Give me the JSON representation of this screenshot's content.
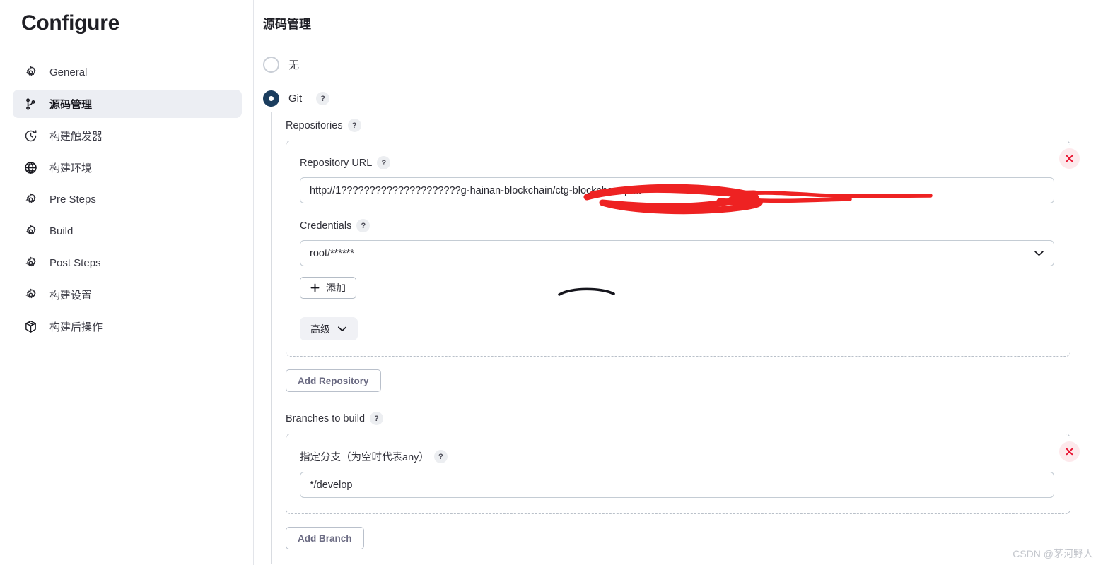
{
  "page": {
    "title": "Configure",
    "watermark": "CSDN @茅河野人"
  },
  "sidebar": {
    "items": [
      {
        "label": "General",
        "icon": "gear-icon",
        "active": false
      },
      {
        "label": "源码管理",
        "icon": "git-branch-icon",
        "active": true
      },
      {
        "label": "构建触发器",
        "icon": "clock-icon",
        "active": false
      },
      {
        "label": "构建环境",
        "icon": "globe-icon",
        "active": false
      },
      {
        "label": "Pre Steps",
        "icon": "gear-icon",
        "active": false
      },
      {
        "label": "Build",
        "icon": "gear-icon",
        "active": false
      },
      {
        "label": "Post Steps",
        "icon": "gear-icon",
        "active": false
      },
      {
        "label": "构建设置",
        "icon": "gear-icon",
        "active": false
      },
      {
        "label": "构建后操作",
        "icon": "package-icon",
        "active": false
      }
    ]
  },
  "main": {
    "section_title": "源码管理",
    "scm_options": [
      {
        "label": "无",
        "selected": false
      },
      {
        "label": "Git",
        "selected": true,
        "help": "?"
      }
    ],
    "repositories": {
      "caption": "Repositories",
      "help": "?",
      "repository_url": {
        "label": "Repository URL",
        "help": "?",
        "value": "http://1?????????????????????g-hainan-blockchain/ctg-blockchain-plat",
        "redacted": true
      },
      "credentials": {
        "label": "Credentials",
        "help": "?",
        "value": "root/******"
      },
      "add_credential_button": "添加",
      "add_credential_icon": "plus-icon",
      "advanced_button": "高级",
      "advanced_icon": "chevron-down-icon",
      "delete_icon": "close-icon",
      "add_repository_button": "Add Repository"
    },
    "branches": {
      "caption": "Branches to build",
      "help": "?",
      "branch_specifier": {
        "label": "指定分支（为空时代表any）",
        "help": "?",
        "value": "*/develop"
      },
      "delete_icon": "close-icon",
      "add_branch_button": "Add Branch"
    }
  },
  "colors": {
    "accent": "#1b3d5e",
    "active_nav_bg": "#eceef3",
    "delete_bg": "#fde9ec",
    "delete_fg": "#e8102e",
    "redaction": "#ee2222",
    "button_text": "#6a6a82"
  }
}
